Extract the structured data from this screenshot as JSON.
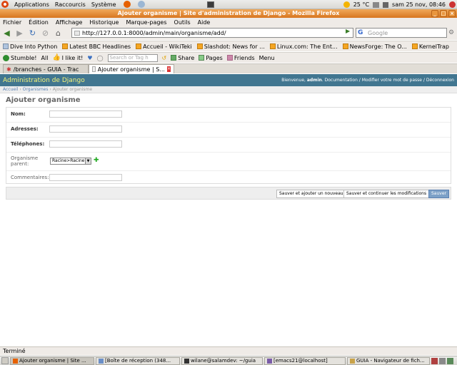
{
  "top_panel": {
    "menus": [
      "Applications",
      "Raccourcis",
      "Système"
    ],
    "weather": "25 °C",
    "datetime": "sam 25 nov, 08:46"
  },
  "window": {
    "title": "Ajouter organisme | Site d'administration de Django - Mozilla Firefox"
  },
  "menubar": [
    "Fichier",
    "Édition",
    "Affichage",
    "Historique",
    "Marque-pages",
    "Outils",
    "Aide"
  ],
  "navbar": {
    "url": "http://127.0.0.1:8000/admin/main/organisme/add/",
    "search_placeholder": "Google"
  },
  "bookmarks": [
    "Dive Into Python",
    "Latest BBC Headlines",
    "Accueil - WikiTeki",
    "Slashdot: News for ...",
    "Linux.com: The Ent...",
    "NewsForge: The O...",
    "KernelTrap"
  ],
  "stumblebar": {
    "stumble": "Stumble!",
    "all": "All",
    "like": "I like it!",
    "tag_placeholder": "Search or Tag h",
    "share": "Share",
    "pages": "Pages",
    "friends": "Friends",
    "menu": "Menu"
  },
  "tabs": [
    {
      "label": "/branches - GUIA - Trac",
      "active": false
    },
    {
      "label": "Ajouter organisme | S...",
      "active": true
    }
  ],
  "django": {
    "brand": "Administration de Django",
    "user_tools": {
      "welcome": "Bienvenue,",
      "user": "admin",
      "links": ". Documentation / Modifier votre mot de passe / Déconnexion"
    },
    "breadcrumbs": {
      "home": "Accueil",
      "model": "Organismes",
      "current": "Ajouter organisme"
    },
    "title": "Ajouter organisme",
    "fields": [
      {
        "label": "Nom:",
        "required": true,
        "value": ""
      },
      {
        "label": "Adresses:",
        "required": true,
        "value": ""
      },
      {
        "label": "Téléphones:",
        "required": true,
        "value": ""
      }
    ],
    "parent": {
      "label_line1": "Organisme",
      "label_line2": "parent:",
      "selected": "Racine>Racine"
    },
    "comments": {
      "label": "Commentaires:",
      "value": ""
    },
    "buttons": {
      "save_add": "Sauver et ajouter un nouveau",
      "save_continue": "Sauver et continuer les modifications",
      "save": "Sauver"
    }
  },
  "status": "Terminé",
  "taskbar": [
    {
      "label": "Ajouter organisme | Site ...",
      "active": true
    },
    {
      "label": "[Boîte de réception (348...",
      "active": false
    },
    {
      "label": "wilane@salamdev: ~/guia",
      "active": false
    },
    {
      "label": "[emacs21@localhost]",
      "active": false
    },
    {
      "label": "GUIA - Navigateur de fich...",
      "active": false
    }
  ],
  "colors": {
    "django_header": "#417690",
    "django_brand": "#f4f379",
    "title_bar": "#d8761f"
  }
}
